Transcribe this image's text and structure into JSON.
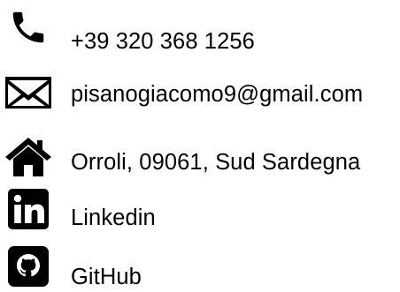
{
  "contacts": {
    "phone": {
      "text": "+39 320 368 1256",
      "icon": "phone-icon"
    },
    "email": {
      "text": "pisanogiacomo9@gmail.com",
      "icon": "envelope-icon"
    },
    "address": {
      "text": "Orroli, 09061, Sud Sardegna",
      "icon": "home-icon"
    },
    "linkedin": {
      "text": "Linkedin",
      "icon": "linkedin-icon"
    },
    "github": {
      "text": "GitHub",
      "icon": "github-icon"
    }
  },
  "colors": {
    "text": "#000000",
    "icon": "#000000",
    "background": "#ffffff"
  }
}
